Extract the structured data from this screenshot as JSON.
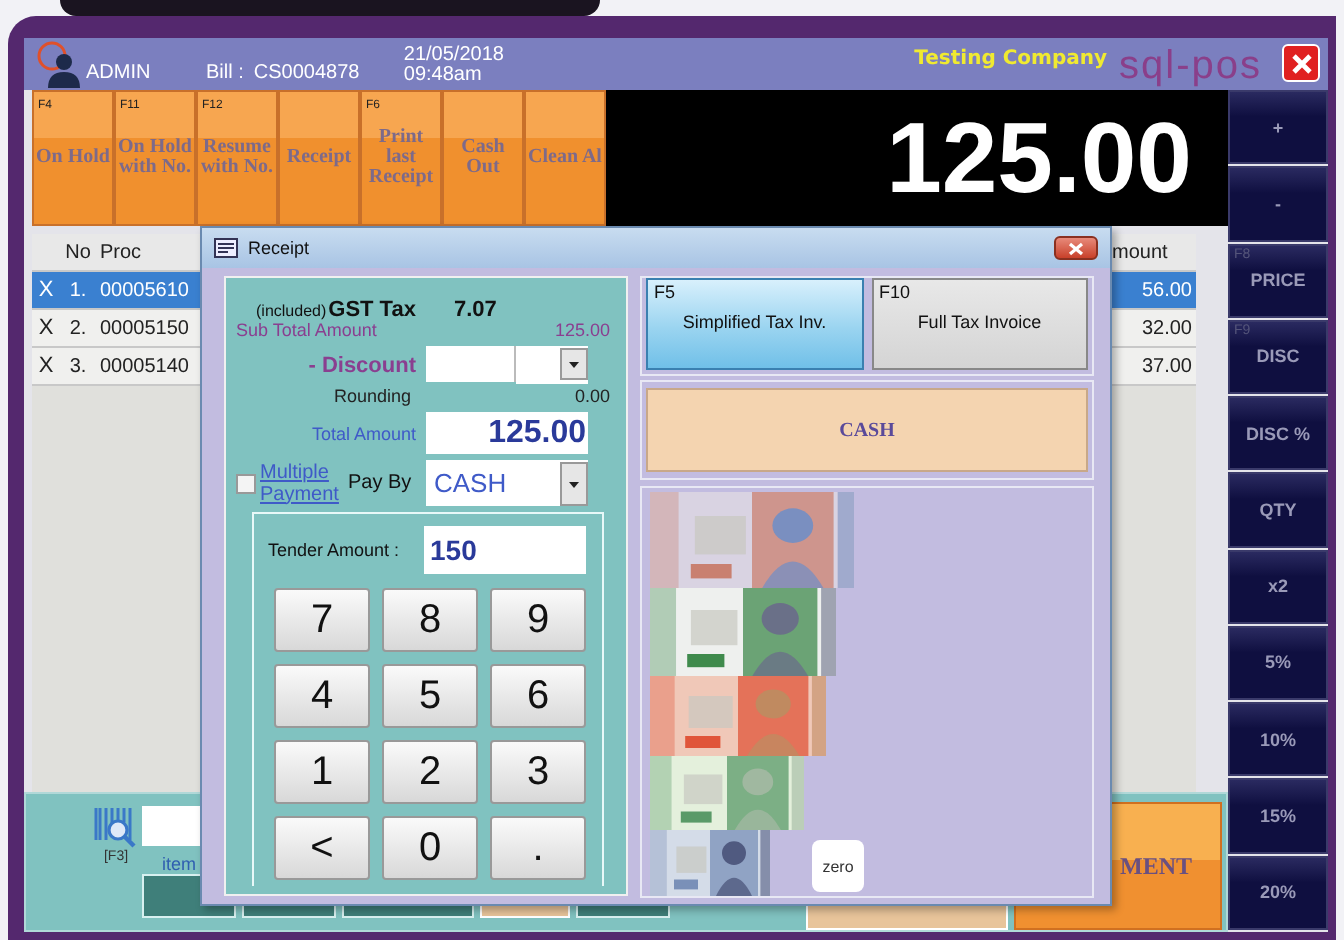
{
  "header": {
    "user": "ADMIN",
    "bill_label": "Bill :",
    "bill_no": "CS0004878",
    "date": "21/05/2018",
    "time": "09:48am",
    "company": "Testing Company",
    "brand": "sql-pos"
  },
  "function_buttons": [
    {
      "key": "F4",
      "label": "On Hold"
    },
    {
      "key": "F11",
      "label": "On Hold with No."
    },
    {
      "key": "F12",
      "label": "Resume with No."
    },
    {
      "label": "Receipt"
    },
    {
      "key": "F6",
      "label": "Print last Receipt"
    },
    {
      "label": "Cash Out"
    },
    {
      "label": "Clean Al"
    }
  ],
  "display": {
    "total": "125.00"
  },
  "side_buttons": [
    {
      "label": "+"
    },
    {
      "label": "-"
    },
    {
      "key": "F8",
      "label": "PRICE"
    },
    {
      "key": "F9",
      "label": "DISC"
    },
    {
      "label": "DISC %"
    },
    {
      "label": "QTY"
    },
    {
      "label": "x2"
    },
    {
      "label": "5%"
    },
    {
      "label": "10%"
    },
    {
      "label": "15%"
    },
    {
      "label": "20%"
    }
  ],
  "table": {
    "columns": [
      "No",
      "Proc",
      "mount"
    ],
    "rows": [
      {
        "remove": "X",
        "no": "1.",
        "code": "00005610",
        "amount": "56.00",
        "selected": true
      },
      {
        "remove": "X",
        "no": "2.",
        "code": "00005150",
        "amount": "32.00",
        "selected": false
      },
      {
        "remove": "X",
        "no": "3.",
        "code": "00005140",
        "amount": "37.00",
        "selected": false
      }
    ]
  },
  "bottom": {
    "search_key": "[F3]",
    "hint": "item",
    "pay_button": "MENT"
  },
  "dialog": {
    "title": "Receipt",
    "gst_prefix": "(included)",
    "gst_label": "GST Tax",
    "gst_value": "7.07",
    "subtotal_label": "Sub Total Amount",
    "subtotal_value": "125.00",
    "discount_label": "- Discount",
    "rounding_label": "Rounding",
    "rounding_value": "0.00",
    "total_label": "Total Amount",
    "total_value": "125.00",
    "multiple_payment": {
      "label": "Multiple Payment",
      "checked": false
    },
    "pay_by_label": "Pay By",
    "pay_by_value": "CASH",
    "tender_label": "Tender Amount :",
    "tender_value": "150",
    "keypad": [
      "7",
      "8",
      "9",
      "4",
      "5",
      "6",
      "1",
      "2",
      "3",
      "<",
      "0",
      "."
    ],
    "invoice_types": [
      {
        "key": "F5",
        "label": "Simplified Tax Inv.",
        "selected": true
      },
      {
        "key": "F10",
        "label": "Full Tax Invoice",
        "selected": false
      }
    ],
    "payment_method": "CASH",
    "zero_button": "zero"
  }
}
